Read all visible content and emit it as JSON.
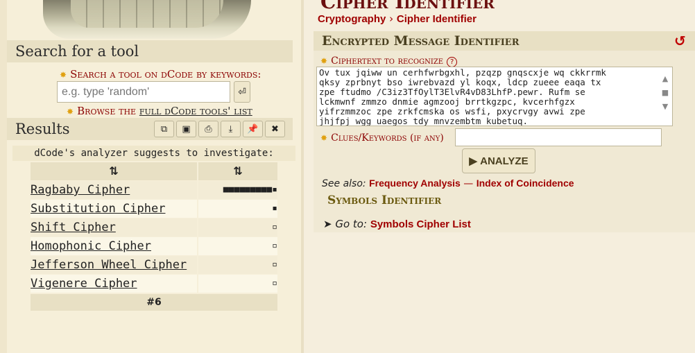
{
  "left": {
    "search_title": "Search for a tool",
    "search_label": "Search a tool on dCode by keywords:",
    "search_placeholder": "e.g. type 'random'",
    "browse_prefix": "Browse the ",
    "browse_link": "full dCode tools' list",
    "results_title": "Results",
    "suggest_text": "dCode's analyzer suggests to investigate:",
    "col1_header": "⇅",
    "col2_header": "⇅",
    "rows": [
      {
        "name": "Ragbaby Cipher",
        "score": "■■■■■■■■■▪"
      },
      {
        "name": "Substitution Cipher",
        "score": "▪"
      },
      {
        "name": "Shift Cipher",
        "score": "▫"
      },
      {
        "name": "Homophonic Cipher",
        "score": "▫"
      },
      {
        "name": "Jefferson Wheel Cipher",
        "score": "▫"
      },
      {
        "name": "Vigenere Cipher",
        "score": "▫"
      }
    ],
    "footer": "#6"
  },
  "right": {
    "page_title": "Cipher Identifier",
    "breadcrumb_1": "Cryptography",
    "breadcrumb_sep": "›",
    "breadcrumb_2": "Cipher Identifier",
    "section_title": "Encrypted Message Identifier",
    "ciphertext_label": "Ciphertext to recognize",
    "ciphertext_value": "Ov tux jqiww un cerhfwrbgxhl, pzqzp gnqscxje wq ckkrrmk\nqksy zprbnyt bso iwrebvazd yl koqx, ldcp zueee eaqa tx\nzpe ftudmo /C3iz3TfOylT3ElvR4vD83LhfP.pewr. Rufm se\nlckmwnf zmmzo dnmie agmzooj brrtkgzpc, kvcerhfgzx\nyifrzmmzoc zpe zrkfcmska os wsfi, pxycrvgy avwi zpe\njhjfpj wgg uaegos tdy mnvzembtm kubetuq.",
    "clues_label": "Clues/Keywords (if any)",
    "clues_value": "",
    "analyze_label": "ANALYZE",
    "see_also_label": "See also:",
    "see_also_1": "Frequency Analysis",
    "see_also_sep": "—",
    "see_also_2": "Index of Coincidence",
    "symbols_title": "Symbols Identifier",
    "goto_label": "Go to:",
    "goto_link": "Symbols Cipher List"
  },
  "colors": {
    "accent_red": "#a00000",
    "section_bg": "#e8e0c4",
    "title_olive": "#6b5a10"
  }
}
